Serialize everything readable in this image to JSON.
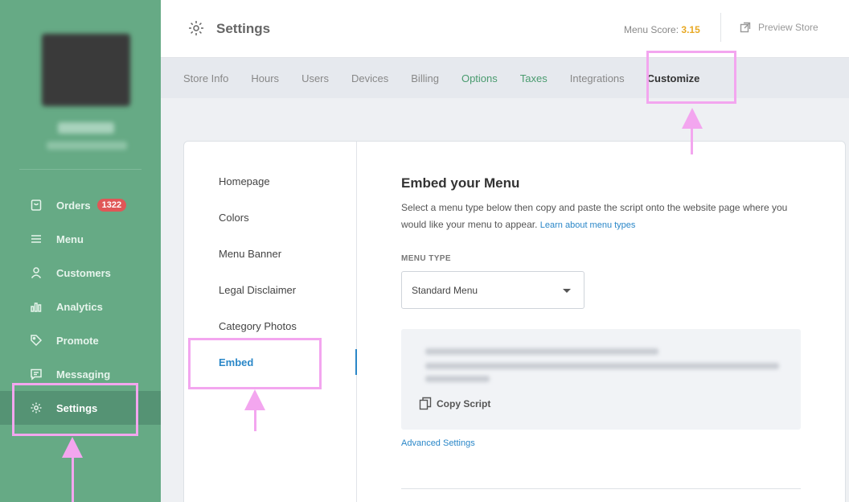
{
  "sidebar": {
    "items": [
      {
        "label": "Orders",
        "icon": "shopping-bag-icon",
        "badge": "1322"
      },
      {
        "label": "Menu",
        "icon": "hamburger-icon"
      },
      {
        "label": "Customers",
        "icon": "person-icon"
      },
      {
        "label": "Analytics",
        "icon": "bar-chart-icon"
      },
      {
        "label": "Promote",
        "icon": "tag-icon"
      },
      {
        "label": "Messaging",
        "icon": "chat-icon"
      },
      {
        "label": "Settings",
        "icon": "gear-icon",
        "active": true
      }
    ]
  },
  "header": {
    "title": "Settings",
    "menu_score_label": "Menu Score:",
    "menu_score_value": "3.15",
    "preview_store": "Preview Store"
  },
  "tabs": [
    {
      "label": "Store Info"
    },
    {
      "label": "Hours"
    },
    {
      "label": "Users"
    },
    {
      "label": "Devices"
    },
    {
      "label": "Billing"
    },
    {
      "label": "Options"
    },
    {
      "label": "Taxes"
    },
    {
      "label": "Integrations"
    },
    {
      "label": "Customize",
      "active": true
    }
  ],
  "subnav": {
    "items": [
      {
        "label": "Homepage"
      },
      {
        "label": "Colors"
      },
      {
        "label": "Menu Banner"
      },
      {
        "label": "Legal Disclaimer"
      },
      {
        "label": "Category Photos"
      },
      {
        "label": "Embed",
        "active": true
      }
    ]
  },
  "content": {
    "title": "Embed your Menu",
    "description": "Select a menu type below then copy and paste the script onto the website page where you would like your menu to appear.",
    "learn_link": "Learn about menu types",
    "menu_type_label": "MENU TYPE",
    "menu_type_value": "Standard Menu",
    "copy_script": "Copy Script",
    "advanced_settings": "Advanced Settings"
  },
  "colors": {
    "sidebar": "#66aa85",
    "accent_blue": "#2a87c8",
    "score": "#e8a924",
    "badge": "#e05757",
    "annotation": "#f3a6ef"
  }
}
